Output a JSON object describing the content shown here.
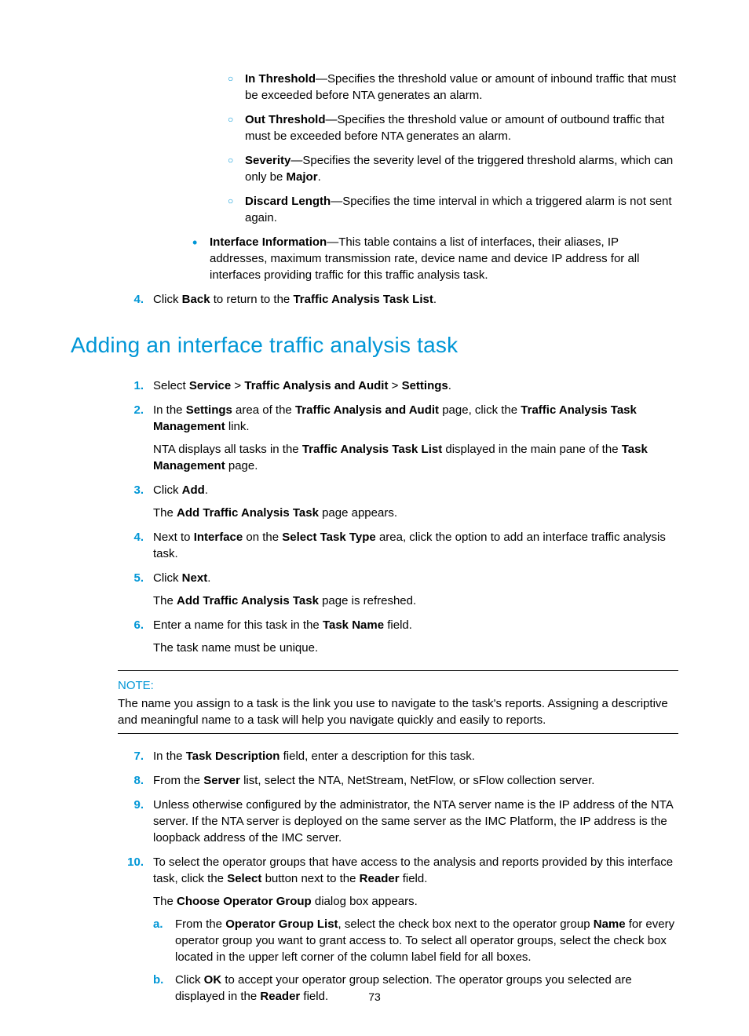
{
  "sub_items": [
    {
      "term": "In Threshold",
      "rest": "—Specifies the threshold value or amount of inbound traffic that must be exceeded before NTA generates an alarm."
    },
    {
      "term": "Out Threshold",
      "rest": "—Specifies the threshold value or amount of outbound traffic that must be exceeded before NTA generates an alarm."
    },
    {
      "term": "Severity",
      "rest_before": "—Specifies the severity level of the triggered threshold alarms, which can only be ",
      "term2": "Major",
      "rest_after": "."
    },
    {
      "term": "Discard Length",
      "rest": "—Specifies the time interval in which a triggered alarm is not sent again."
    }
  ],
  "bullet": {
    "term": "Interface Information",
    "rest": "—This table contains a list of interfaces, their aliases, IP addresses, maximum transmission rate, device name and device IP address for all interfaces providing traffic for this traffic analysis task."
  },
  "back_step": {
    "num": "4.",
    "t1": "Click ",
    "b1": "Back",
    "t2": " to return to the ",
    "b2": "Traffic Analysis Task List",
    "t3": "."
  },
  "heading": "Adding an interface traffic analysis task",
  "steps": [
    {
      "num": "1.",
      "parts": [
        {
          "t": "Select "
        },
        {
          "b": "Service"
        },
        {
          "t": " > "
        },
        {
          "b": "Traffic Analysis and Audit"
        },
        {
          "t": " > "
        },
        {
          "b": "Settings"
        },
        {
          "t": "."
        }
      ]
    },
    {
      "num": "2.",
      "paras": [
        [
          {
            "t": "In the "
          },
          {
            "b": "Settings"
          },
          {
            "t": " area of the "
          },
          {
            "b": "Traffic Analysis and Audit"
          },
          {
            "t": " page, click the "
          },
          {
            "b": "Traffic Analysis Task Management"
          },
          {
            "t": " link."
          }
        ],
        [
          {
            "t": "NTA displays all tasks in the "
          },
          {
            "b": "Traffic Analysis Task List"
          },
          {
            "t": " displayed in the main pane of the "
          },
          {
            "b": "Task Management"
          },
          {
            "t": " page."
          }
        ]
      ]
    },
    {
      "num": "3.",
      "paras": [
        [
          {
            "t": "Click "
          },
          {
            "b": "Add"
          },
          {
            "t": "."
          }
        ],
        [
          {
            "t": "The "
          },
          {
            "b": "Add Traffic Analysis Task"
          },
          {
            "t": " page appears."
          }
        ]
      ]
    },
    {
      "num": "4.",
      "parts": [
        {
          "t": "Next to "
        },
        {
          "b": "Interface"
        },
        {
          "t": " on the "
        },
        {
          "b": "Select Task Type"
        },
        {
          "t": " area, click the option to add an interface traffic analysis task."
        }
      ]
    },
    {
      "num": "5.",
      "paras": [
        [
          {
            "t": "Click "
          },
          {
            "b": "Next"
          },
          {
            "t": "."
          }
        ],
        [
          {
            "t": "The "
          },
          {
            "b": "Add Traffic Analysis Task"
          },
          {
            "t": " page is refreshed."
          }
        ]
      ]
    },
    {
      "num": "6.",
      "paras": [
        [
          {
            "t": "Enter a name for this task in the "
          },
          {
            "b": "Task Name"
          },
          {
            "t": " field."
          }
        ],
        [
          {
            "t": "The task name must be unique."
          }
        ]
      ]
    }
  ],
  "note": {
    "label": "NOTE:",
    "text": "The name you assign to a task is the link you use to navigate to the task's reports. Assigning a descriptive and meaningful name to a task will help you navigate quickly and easily to reports."
  },
  "steps2": [
    {
      "num": "7.",
      "parts": [
        {
          "t": "In the "
        },
        {
          "b": "Task Description"
        },
        {
          "t": " field, enter a description for this task."
        }
      ]
    },
    {
      "num": "8.",
      "parts": [
        {
          "t": "From the "
        },
        {
          "b": "Server"
        },
        {
          "t": " list, select the NTA, NetStream, NetFlow, or sFlow collection server."
        }
      ]
    },
    {
      "num": "9.",
      "parts": [
        {
          "t": "Unless otherwise configured by the administrator, the NTA server name is the IP address of the NTA server. If the NTA server is deployed on the same server as the IMC Platform, the IP address is the loopback address of the IMC server."
        }
      ]
    },
    {
      "num": "10.",
      "paras": [
        [
          {
            "t": "To select the operator groups that have access to the analysis and reports provided by this interface task, click the "
          },
          {
            "b": "Select"
          },
          {
            "t": " button next to the "
          },
          {
            "b": "Reader"
          },
          {
            "t": " field."
          }
        ],
        [
          {
            "t": "The "
          },
          {
            "b": "Choose Operator Group"
          },
          {
            "t": " dialog box appears."
          }
        ]
      ],
      "alpha": [
        {
          "m": "a.",
          "parts": [
            {
              "t": "From the "
            },
            {
              "b": "Operator Group List"
            },
            {
              "t": ", select the check box next to the operator group "
            },
            {
              "b": "Name"
            },
            {
              "t": " for every operator group you want to grant access to. To select all operator groups, select the check box located in the upper left corner of the column label field for all boxes."
            }
          ]
        },
        {
          "m": "b.",
          "parts": [
            {
              "t": "Click "
            },
            {
              "b": "OK"
            },
            {
              "t": " to accept your operator group selection. The operator groups you selected are displayed in the "
            },
            {
              "b": "Reader"
            },
            {
              "t": " field."
            }
          ]
        }
      ]
    }
  ],
  "pagenum": "73"
}
